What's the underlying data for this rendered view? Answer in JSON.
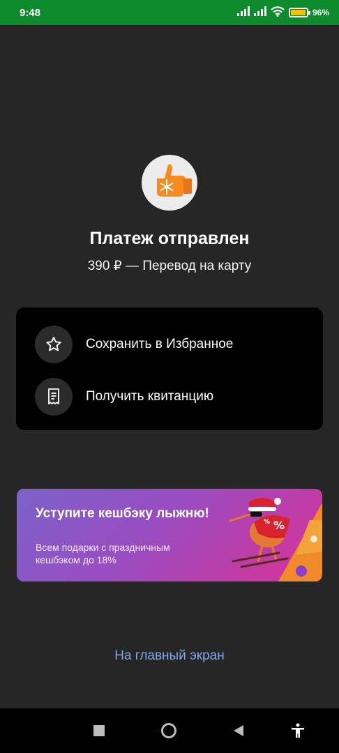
{
  "status_bar": {
    "time": "9:48",
    "battery_percent": "96",
    "battery_suffix": "%",
    "icons": [
      "signal-icon",
      "signal-icon",
      "wifi-icon",
      "battery-icon"
    ]
  },
  "result": {
    "icon": "thumbs-up-mitten-icon",
    "title": "Платеж отправлен",
    "subtitle": "390 ₽ — Перевод на карту"
  },
  "actions": [
    {
      "icon": "star-icon",
      "label": "Сохранить в Избранное"
    },
    {
      "icon": "receipt-icon",
      "label": "Получить квитанцию"
    }
  ],
  "promo": {
    "title": "Уступите кешбэку лыжню!",
    "text": "Всем подарки с праздничным кешбэком до 18%"
  },
  "home_link": "На главный экран",
  "navbar": {
    "icons": [
      "recents-square-icon",
      "home-circle-icon",
      "back-triangle-icon",
      "accessibility-icon"
    ]
  },
  "colors": {
    "status_bar": "#0d8a2b",
    "background": "#262626",
    "card": "#000000",
    "link": "#7fa8e8",
    "accent_orange": "#f58a1f"
  }
}
